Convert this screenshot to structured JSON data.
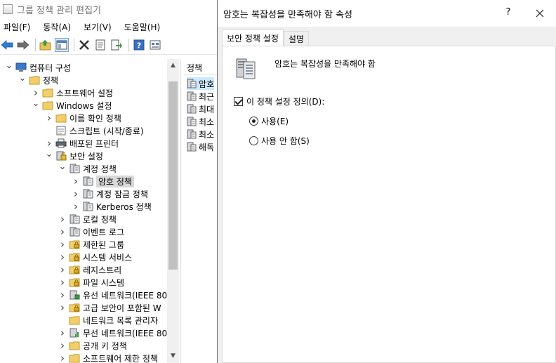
{
  "window": {
    "title": "그룹 정책 관리 편집기"
  },
  "menu": [
    "파일(F)",
    "동작(A)",
    "보기(V)",
    "도움말(H)"
  ],
  "toolbar": [
    "back-icon",
    "forward-icon",
    "up-folder-icon",
    "show-hide-tree-icon",
    "delete-icon",
    "properties-icon",
    "export-icon",
    "help-icon",
    "view-icon"
  ],
  "tree": [
    {
      "label": "컴퓨터 구성",
      "icon": "computer-icon",
      "depth": 0,
      "chevron": "down"
    },
    {
      "label": "정책",
      "icon": "folder-icon",
      "depth": 1,
      "chevron": "down"
    },
    {
      "label": "소프트웨어 설정",
      "icon": "folder-icon",
      "depth": 2,
      "chevron": "right"
    },
    {
      "label": "Windows 설정",
      "icon": "folder-icon",
      "depth": 2,
      "chevron": "down"
    },
    {
      "label": "이름 확인 정책",
      "icon": "folder-icon",
      "depth": 3,
      "chevron": "right"
    },
    {
      "label": "스크립트 (시작/종료)",
      "icon": "script-icon",
      "depth": 3,
      "chevron": "none"
    },
    {
      "label": "배포된 프린터",
      "icon": "printer-icon",
      "depth": 3,
      "chevron": "right"
    },
    {
      "label": "보안 설정",
      "icon": "security-icon",
      "depth": 3,
      "chevron": "down"
    },
    {
      "label": "계정 정책",
      "icon": "policy-folder-icon",
      "depth": 4,
      "chevron": "down"
    },
    {
      "label": "암호 정책",
      "icon": "policy-folder-icon",
      "depth": 5,
      "chevron": "right",
      "selected": true
    },
    {
      "label": "계정 잠금 정책",
      "icon": "policy-folder-icon",
      "depth": 5,
      "chevron": "right"
    },
    {
      "label": "Kerberos 정책",
      "icon": "policy-folder-icon",
      "depth": 5,
      "chevron": "right"
    },
    {
      "label": "로컬 정책",
      "icon": "policy-folder-icon",
      "depth": 4,
      "chevron": "right"
    },
    {
      "label": "이벤트 로그",
      "icon": "policy-folder-icon",
      "depth": 4,
      "chevron": "right"
    },
    {
      "label": "제한된 그룹",
      "icon": "lock-folder-icon",
      "depth": 4,
      "chevron": "right"
    },
    {
      "label": "시스템 서비스",
      "icon": "lock-folder-icon",
      "depth": 4,
      "chevron": "right"
    },
    {
      "label": "레지스트리",
      "icon": "lock-folder-icon",
      "depth": 4,
      "chevron": "right"
    },
    {
      "label": "파일 시스템",
      "icon": "lock-folder-icon",
      "depth": 4,
      "chevron": "right"
    },
    {
      "label": "유선 네트워크(IEEE 80",
      "icon": "network-icon",
      "depth": 4,
      "chevron": "right"
    },
    {
      "label": "고급 보안이 포함된 W",
      "icon": "lock-folder-icon",
      "depth": 4,
      "chevron": "right"
    },
    {
      "label": "네트워크 목록 관리자",
      "icon": "folder-icon",
      "depth": 4,
      "chevron": "none"
    },
    {
      "label": "무선 네트워크(IEEE 80",
      "icon": "wireless-icon",
      "depth": 4,
      "chevron": "right"
    },
    {
      "label": "공개 키 정책",
      "icon": "folder-icon",
      "depth": 4,
      "chevron": "right"
    },
    {
      "label": "소프트웨어 제한 정책",
      "icon": "folder-icon",
      "depth": 4,
      "chevron": "right"
    }
  ],
  "list": {
    "header": "정책",
    "items": [
      "암호",
      "최근",
      "최대",
      "최소",
      "최소",
      "해독"
    ]
  },
  "dialog": {
    "title": "암호는 복잡성을 만족해야 함 속성",
    "help_label": "?",
    "tabs": [
      "보안 정책 설정",
      "설명"
    ],
    "heading": "암호는 복잡성을 만족해야 함",
    "define_label": "이 정책 설정 정의(D):",
    "define_checked": true,
    "options": [
      {
        "label": "사용(E)",
        "selected": true
      },
      {
        "label": "사용 안 함(S)",
        "selected": false
      }
    ]
  }
}
